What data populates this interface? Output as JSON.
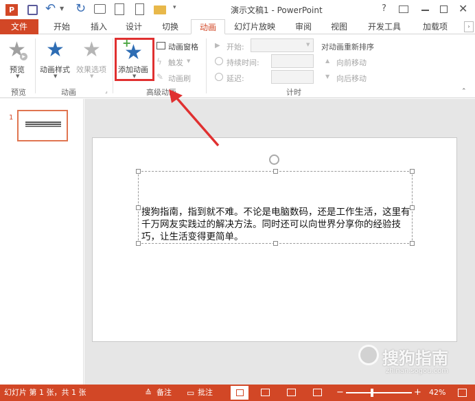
{
  "titlebar": {
    "title": "演示文稿1 - PowerPoint",
    "app_icon_text": "P",
    "help": "?",
    "controls": [
      "restore-ribbon",
      "minimize",
      "maximize",
      "close"
    ]
  },
  "tabs": [
    "文件",
    "开始",
    "插入",
    "设计",
    "切换",
    "动画",
    "幻灯片放映",
    "审阅",
    "视图",
    "开发工具",
    "加载项"
  ],
  "active_tab": "动画",
  "ribbon": {
    "preview": {
      "label": "预览",
      "group": "预览"
    },
    "animation_group": {
      "label": "动画",
      "style_label": "动画样式",
      "effect_label": "效果选项"
    },
    "advanced_group": {
      "label": "高级动画",
      "add_label": "添加动画",
      "pane_label": "动画窗格",
      "trigger_label": "触发",
      "painter_label": "动画刷"
    },
    "timing_group": {
      "label": "计时",
      "start_label": "开始:",
      "duration_label": "持续时间:",
      "delay_label": "延迟:",
      "reorder_label": "对动画重新排序",
      "earlier_label": "向前移动",
      "later_label": "向后移动"
    }
  },
  "thumbnail": {
    "number": "1"
  },
  "slide": {
    "text": "搜狗指南，指到就不难。不论是电脑数码，还是工作生活，这里有千万网友实践过的解决方法。同时还可以向世界分享你的经验技巧，让生活变得更简单。"
  },
  "watermark": {
    "brand": "搜狗指南",
    "url": "zhinan.sogou.com"
  },
  "statusbar": {
    "slide_info": "幻灯片 第 1 张，共 1 张",
    "notes": "备注",
    "comments": "批注",
    "zoom": "42%",
    "zoom_level": 0.42
  },
  "colors": {
    "accent": "#d24726",
    "highlight_box": "#e03030",
    "star_blue": "#2e6db4"
  }
}
